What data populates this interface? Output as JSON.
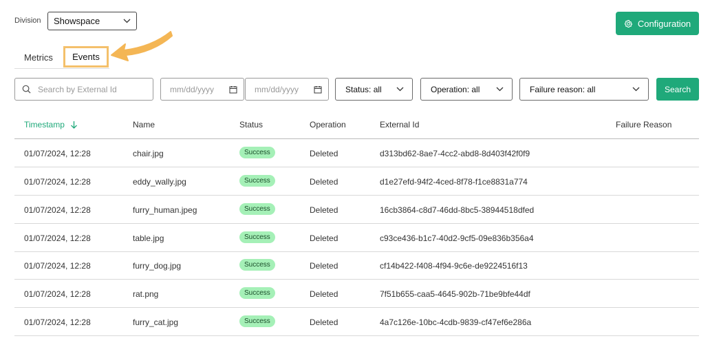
{
  "division": {
    "label": "Division",
    "value": "Showspace"
  },
  "config_button": {
    "label": "Configuration"
  },
  "tabs": [
    {
      "label": "Metrics",
      "active": false
    },
    {
      "label": "Events",
      "active": true
    }
  ],
  "filters": {
    "search_placeholder": "Search by External Id",
    "date_from_placeholder": "mm/dd/yyyy",
    "date_to_placeholder": "mm/dd/yyyy",
    "status": "Status: all",
    "operation": "Operation: all",
    "failure_reason": "Failure reason: all",
    "search_button": "Search"
  },
  "table": {
    "columns": [
      "Timestamp",
      "Name",
      "Status",
      "Operation",
      "External Id",
      "Failure Reason"
    ],
    "rows": [
      {
        "timestamp": "01/07/2024, 12:28",
        "name": "chair.jpg",
        "status": "Success",
        "operation": "Deleted",
        "external_id": "d313bd62-8ae7-4cc2-abd8-8d403f42f0f9",
        "failure_reason": ""
      },
      {
        "timestamp": "01/07/2024, 12:28",
        "name": "eddy_wally.jpg",
        "status": "Success",
        "operation": "Deleted",
        "external_id": "d1e27efd-94f2-4ced-8f78-f1ce8831a774",
        "failure_reason": ""
      },
      {
        "timestamp": "01/07/2024, 12:28",
        "name": "furry_human.jpeg",
        "status": "Success",
        "operation": "Deleted",
        "external_id": "16cb3864-c8d7-46dd-8bc5-38944518dfed",
        "failure_reason": ""
      },
      {
        "timestamp": "01/07/2024, 12:28",
        "name": "table.jpg",
        "status": "Success",
        "operation": "Deleted",
        "external_id": "c93ce436-b1c7-40d2-9cf5-09e836b356a4",
        "failure_reason": ""
      },
      {
        "timestamp": "01/07/2024, 12:28",
        "name": "furry_dog.jpg",
        "status": "Success",
        "operation": "Deleted",
        "external_id": "cf14b422-f408-4f94-9c6e-de9224516f13",
        "failure_reason": ""
      },
      {
        "timestamp": "01/07/2024, 12:28",
        "name": "rat.png",
        "status": "Success",
        "operation": "Deleted",
        "external_id": "7f51b655-caa5-4645-902b-71be9bfe44df",
        "failure_reason": ""
      },
      {
        "timestamp": "01/07/2024, 12:28",
        "name": "furry_cat.jpg",
        "status": "Success",
        "operation": "Deleted",
        "external_id": "4a7c126e-10bc-4cdb-9839-cf47ef6e286a",
        "failure_reason": ""
      }
    ]
  },
  "colors": {
    "accent": "#1fa97a",
    "badge_bg": "#a5f0b7",
    "highlight": "#f4c06b"
  }
}
